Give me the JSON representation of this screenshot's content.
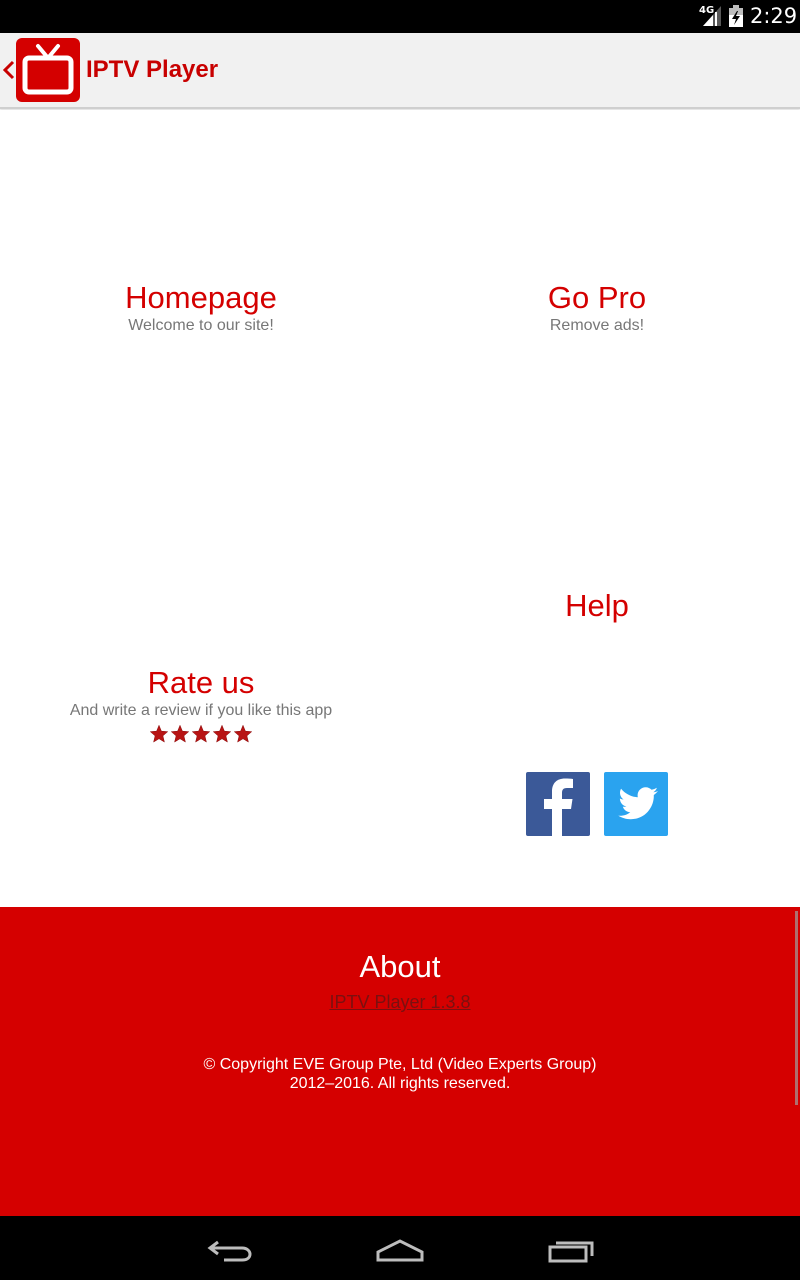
{
  "status_bar": {
    "network": "4G",
    "time": "2:29"
  },
  "action_bar": {
    "title": "IPTV Player",
    "back_icon": "chevron-left-icon",
    "logo_icon": "tv-icon"
  },
  "tiles": {
    "homepage": {
      "title": "Homepage",
      "subtitle": "Welcome to our site!"
    },
    "go_pro": {
      "title": "Go Pro",
      "subtitle": "Remove ads!"
    },
    "help": {
      "title": "Help"
    },
    "rate_us": {
      "title": "Rate us",
      "subtitle": "And write a review if you like this app",
      "rating": 5,
      "max_rating": 5
    }
  },
  "social": {
    "facebook_icon": "facebook-icon",
    "twitter_icon": "twitter-icon"
  },
  "about": {
    "title": "About",
    "version": "IPTV Player 1.3.8",
    "copyright_line1": "© Copyright EVE Group Pte, Ltd (Video Experts Group)",
    "copyright_line2": "2012–2016. All rights reserved."
  },
  "colors": {
    "brand_red": "#d40000",
    "facebook_blue": "#3b5998",
    "twitter_blue": "#2aa3ef"
  }
}
